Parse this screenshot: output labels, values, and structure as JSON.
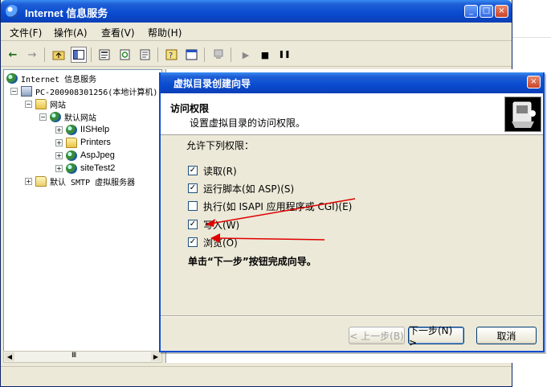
{
  "window": {
    "title": "Internet 信息服务",
    "minimize": "_",
    "maximize": "□",
    "close": "×"
  },
  "menu": [
    "文件(F)",
    "操作(A)",
    "查看(V)",
    "帮助(H)"
  ],
  "toolbar": {
    "back": "←",
    "forward": "→",
    "play": "▶",
    "stop": "■",
    "pause": "❚❚"
  },
  "tree": {
    "root": "Internet 信息服务",
    "computer": "PC-200908301256(本地计算机)",
    "sites_folder": "网站",
    "default_site": "默认网站",
    "children": [
      "IISHelp",
      "Printers",
      "AspJpeg",
      "siteTest2"
    ],
    "smtp": "默认 SMTP 虚拟服务器",
    "scroll_label": "Ⅲ"
  },
  "wizard": {
    "title": "虚拟目录创建向导",
    "close": "×",
    "header_title": "访问权限",
    "header_subtitle": "设置虚拟目录的访问权限。",
    "permissions_label": "允许下列权限：",
    "permissions": [
      {
        "label": "读取(R)",
        "checked": true,
        "mark": "✓"
      },
      {
        "label": "运行脚本(如 ASP)(S)",
        "checked": true,
        "mark": "✓"
      },
      {
        "label": "执行(如 ISAPI 应用程序或 CGI)(E)",
        "checked": false,
        "mark": ""
      },
      {
        "label": "写入(W)",
        "checked": true,
        "mark": "✓"
      },
      {
        "label": "浏览(O)",
        "checked": true,
        "mark": "✓"
      }
    ],
    "instruction": "单击“下一步”按钮完成向导。",
    "buttons": {
      "back": "< 上一步(B)",
      "next": "下一步(N) >",
      "cancel": "取消"
    }
  },
  "colors": {
    "titlebar": "#0a4bd0",
    "face": "#ece9d8",
    "annotation_arrow": "#e00000"
  }
}
